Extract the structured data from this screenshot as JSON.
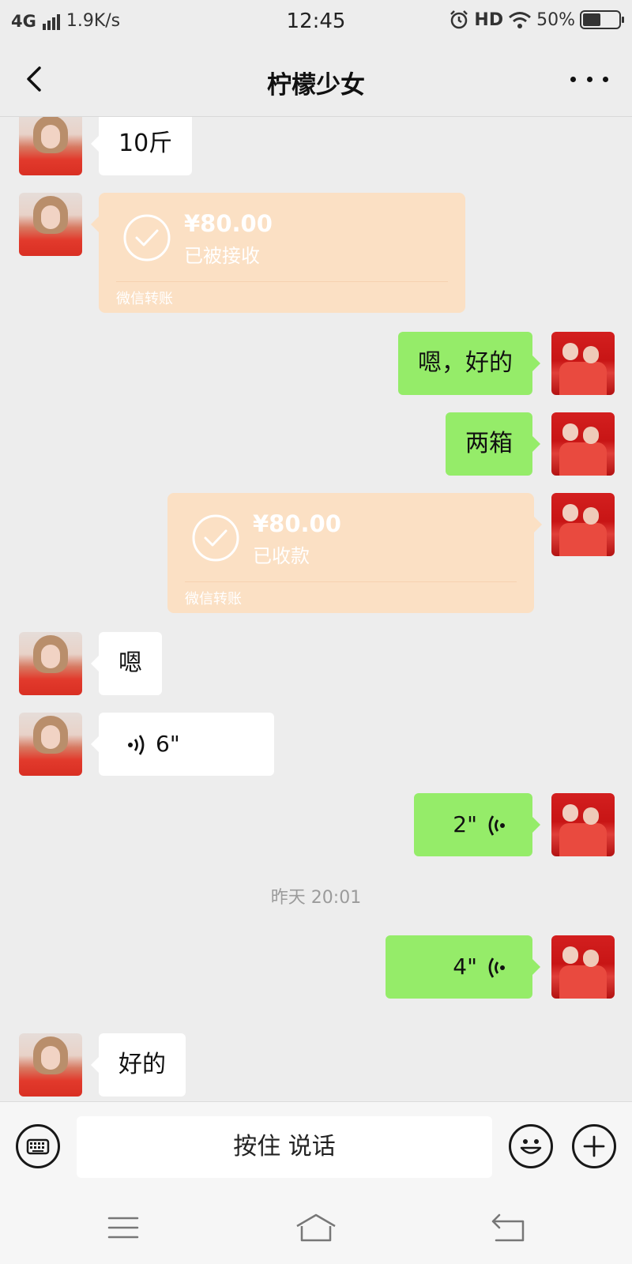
{
  "status_bar": {
    "network": "4G",
    "speed": "1.9K/s",
    "time": "12:45",
    "hd": "HD",
    "battery": "50%",
    "battery_level": 0.5
  },
  "nav": {
    "title": "柠檬少女"
  },
  "messages": [
    {
      "type": "text",
      "side": "in",
      "text": "10斤"
    },
    {
      "type": "transfer",
      "side": "in",
      "amount": "¥80.00",
      "status": "已被接收",
      "brand": "微信转账"
    },
    {
      "type": "text",
      "side": "out",
      "text": "嗯，好的"
    },
    {
      "type": "text",
      "side": "out",
      "text": "两箱"
    },
    {
      "type": "transfer",
      "side": "out",
      "amount": "¥80.00",
      "status": "已收款",
      "brand": "微信转账"
    },
    {
      "type": "text",
      "side": "in",
      "text": "嗯"
    },
    {
      "type": "voice",
      "side": "in",
      "duration": "6\""
    },
    {
      "type": "voice",
      "side": "out",
      "duration": "2\""
    },
    {
      "type": "timestamp",
      "text": "昨天 20:01"
    },
    {
      "type": "voice",
      "side": "out",
      "duration": "4\""
    },
    {
      "type": "text",
      "side": "in",
      "text": "好的"
    }
  ],
  "input": {
    "hold_to_talk": "按住 说话"
  },
  "colors": {
    "background": "#ededed",
    "outgoing_bubble": "#95ec69",
    "incoming_bubble": "#ffffff",
    "transfer_card": "#fbe0c4"
  },
  "icons": [
    "back-arrow-icon",
    "more-icon",
    "keyboard-icon",
    "emoji-icon",
    "plus-icon",
    "voice-wave-icon",
    "check-circle-icon",
    "menu-icon",
    "home-icon",
    "back-icon"
  ]
}
